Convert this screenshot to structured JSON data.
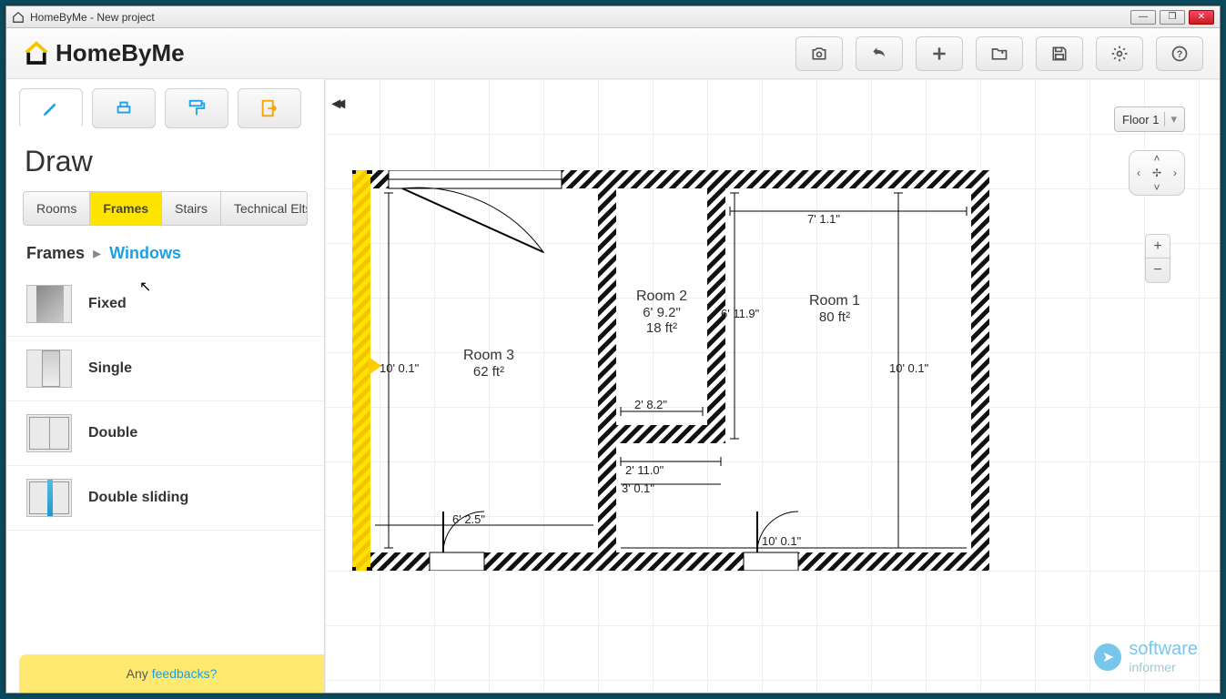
{
  "window": {
    "title": "HomeByMe - New project"
  },
  "app": {
    "name": "HomeByMe"
  },
  "toolbar_icons": {
    "camera": "camera-icon",
    "undo": "undo-icon",
    "add": "plus-icon",
    "open": "folder-icon",
    "save": "save-icon",
    "settings": "gear-icon",
    "help": "help-icon"
  },
  "sidebar": {
    "section_title": "Draw",
    "category_tabs": [
      "Rooms",
      "Frames",
      "Stairs",
      "Technical Elts."
    ],
    "active_category": "Frames",
    "breadcrumb": {
      "root": "Frames",
      "leaf": "Windows"
    },
    "items": [
      {
        "label": "Fixed",
        "thumb": "fixed"
      },
      {
        "label": "Single",
        "thumb": "single"
      },
      {
        "label": "Double",
        "thumb": "double"
      },
      {
        "label": "Double sliding",
        "thumb": "dslide"
      }
    ],
    "feedback_prefix": "Any",
    "feedback_link": "feedbacks?"
  },
  "canvas": {
    "floor_selector": "Floor 1",
    "rooms": {
      "room1": {
        "name": "Room 1",
        "area": "80 ft²"
      },
      "room2": {
        "name": "Room 2",
        "width": "6' 9.2\"",
        "area": "18 ft²"
      },
      "room3": {
        "name": "Room 3",
        "area": "62 ft²"
      }
    },
    "dimensions": {
      "top_right": "7' 1.1\"",
      "left_height": "10' 0.1\"",
      "right_height": "10' 0.1\"",
      "room2_bottom": "2' 8.2\"",
      "mid_height": "6' 11.9\"",
      "hall_top": "2' 11.0\"",
      "hall_bot": "3' 0.1\"",
      "door_left": "6' 2.5\"",
      "door_right": "10' 0.1\""
    }
  },
  "watermark": {
    "line1": "software",
    "line2": "informer"
  }
}
